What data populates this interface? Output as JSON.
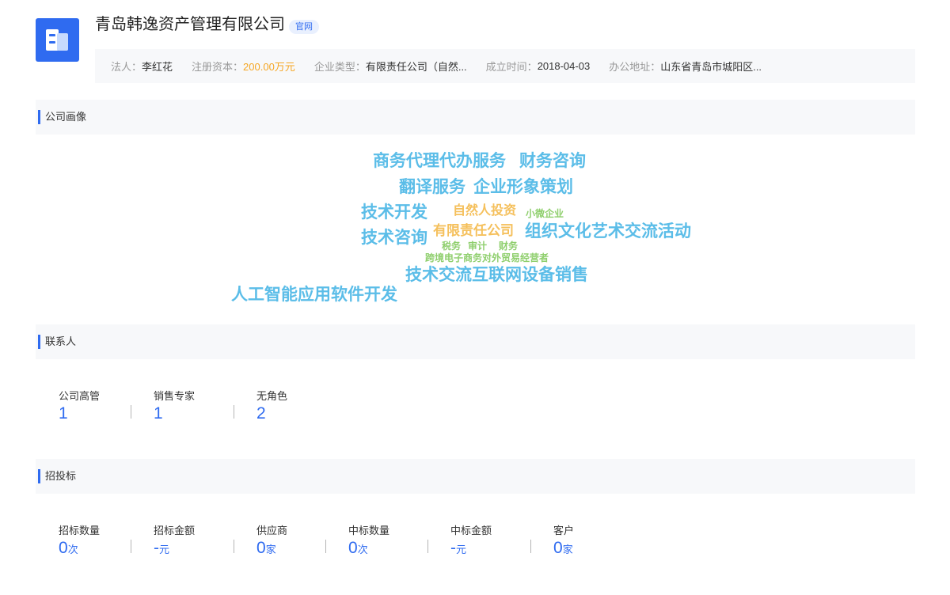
{
  "company": {
    "name": "青岛韩逸资产管理有限公司",
    "official_tag": "官网"
  },
  "info": [
    {
      "label": "法人：",
      "value": "李红花"
    },
    {
      "label": "注册资本：",
      "value": "200.00万元"
    },
    {
      "label": "企业类型：",
      "value": "有限责任公司（自然..."
    },
    {
      "label": "成立时间：",
      "value": "2018-04-03"
    },
    {
      "label": "办公地址：",
      "value": "山东省青岛市城阳区..."
    }
  ],
  "sections": {
    "portrait": "公司画像",
    "contacts": "联系人",
    "bidding": "招投标"
  },
  "tag_cloud": [
    {
      "text": "商务代理代办服务",
      "color": "#5bbde8"
    },
    {
      "text": "财务咨询",
      "color": "#5bbde8"
    },
    {
      "text": "翻译服务",
      "color": "#5bbde8"
    },
    {
      "text": "企业形象策划",
      "color": "#5bbde8"
    },
    {
      "text": "技术开发",
      "color": "#5bbde8"
    },
    {
      "text": "自然人投资",
      "color": "#f5c05c"
    },
    {
      "text": "小微企业",
      "color": "#8fcf6d"
    },
    {
      "text": "技术咨询",
      "color": "#5bbde8"
    },
    {
      "text": "有限责任公司",
      "color": "#f5c05c"
    },
    {
      "text": "组织文化艺术交流活动",
      "color": "#5bbde8"
    },
    {
      "text": "税务",
      "color": "#8fcf6d"
    },
    {
      "text": "审计",
      "color": "#8fcf6d"
    },
    {
      "text": "财务",
      "color": "#8fcf6d"
    },
    {
      "text": "跨境电子商务对外贸易经营者",
      "color": "#8fcf6d"
    },
    {
      "text": "技术交流",
      "color": "#5bbde8"
    },
    {
      "text": "互联网设备销售",
      "color": "#5bbde8"
    },
    {
      "text": "人工智能应用软件开发",
      "color": "#5bbde8"
    }
  ],
  "contacts": [
    {
      "label": "公司高管",
      "value": "1",
      "unit": ""
    },
    {
      "label": "销售专家",
      "value": "1",
      "unit": ""
    },
    {
      "label": "无角色",
      "value": "2",
      "unit": ""
    }
  ],
  "bidding": [
    {
      "label": "招标数量",
      "value": "0",
      "unit": "次"
    },
    {
      "label": "招标金额",
      "value": "-",
      "unit": "元"
    },
    {
      "label": "供应商",
      "value": "0",
      "unit": "家"
    },
    {
      "label": "中标数量",
      "value": "0",
      "unit": "次"
    },
    {
      "label": "中标金额",
      "value": "-",
      "unit": "元"
    },
    {
      "label": "客户",
      "value": "0",
      "unit": "家"
    }
  ],
  "colors": {
    "accent": "#2f6bf0",
    "money": "#f5a623"
  }
}
